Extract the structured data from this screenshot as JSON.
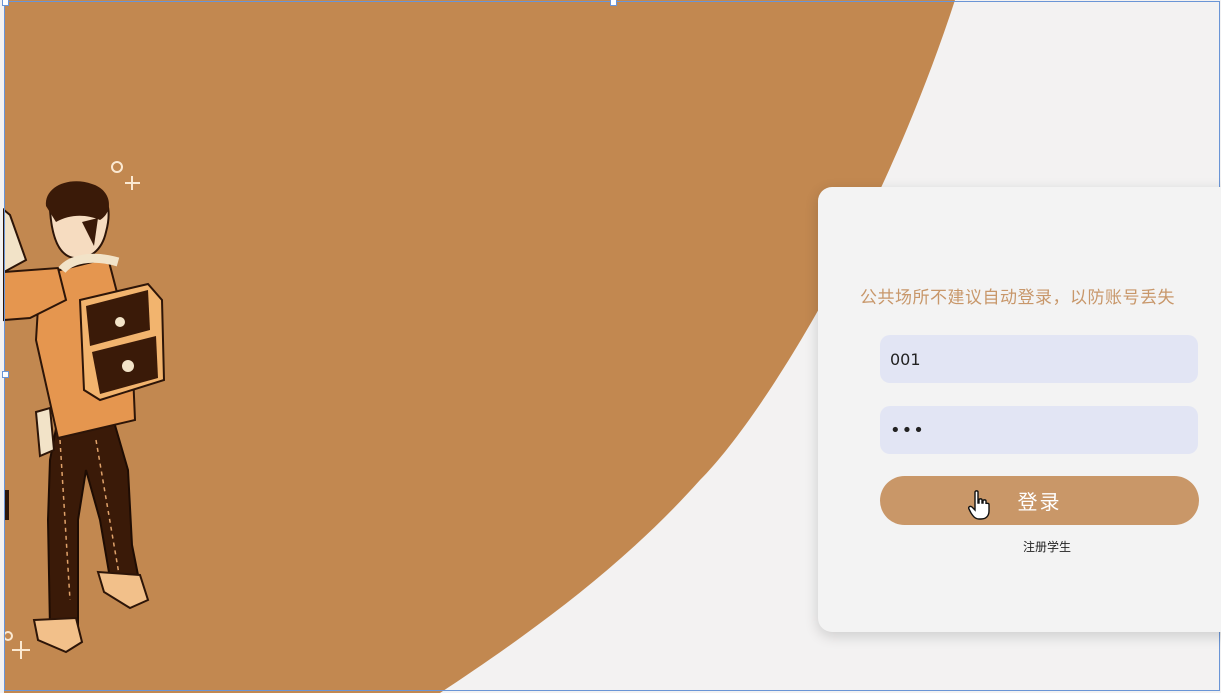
{
  "colors": {
    "brand_brown": "#c28850",
    "page_background": "#f3f2f2",
    "input_background": "#e2e5f4",
    "button_background": "#c99768",
    "notice_text": "#c8976a"
  },
  "illustration": {
    "subject": "person-with-backpack-illustration"
  },
  "login": {
    "notice": "公共场所不建议自动登录，以防账号丢失",
    "username_value": "001",
    "password_value": "•••",
    "login_button": "登录",
    "register_link": "注册学生"
  },
  "cursor": {
    "icon": "hand-pointer-icon"
  }
}
